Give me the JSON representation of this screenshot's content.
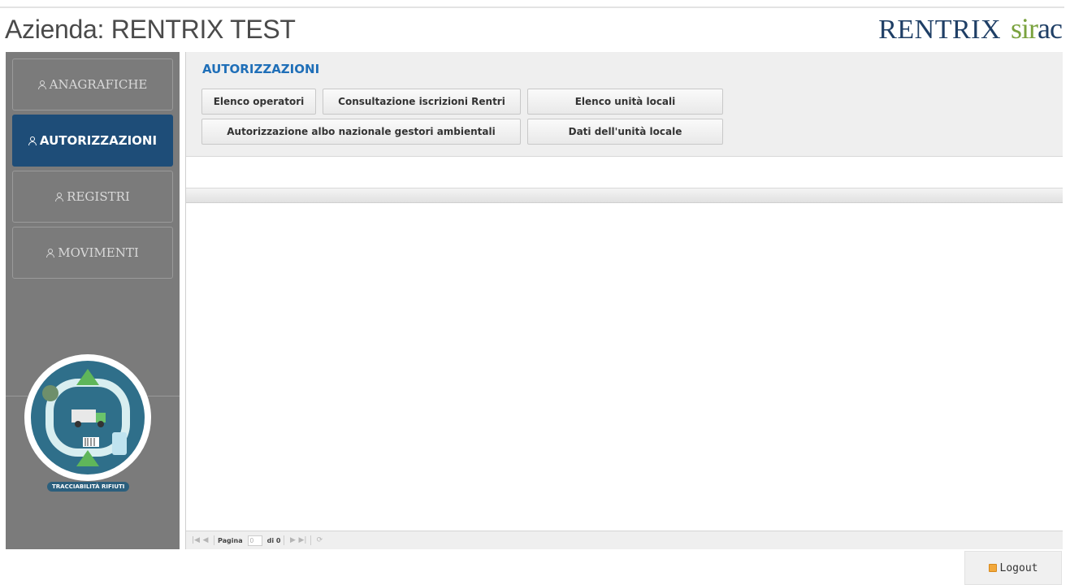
{
  "header": {
    "company_title": "Azienda: RENTRIX TEST",
    "brand_main": "RENTRIX",
    "brand_sub_a": "sir",
    "brand_sub_b": "ac"
  },
  "sidebar": {
    "items": [
      {
        "label": "ANAGRAFICHE",
        "active": false
      },
      {
        "label": "AUTORIZZAZIONI",
        "active": true
      },
      {
        "label": "REGISTRI",
        "active": false
      },
      {
        "label": "MOVIMENTI",
        "active": false
      }
    ],
    "logo_caption": "TRACCIABILITÀ RIFIUTI"
  },
  "main": {
    "section_title": "AUTORIZZAZIONI",
    "buttons": [
      "Elenco operatori",
      "Consultazione iscrizioni Rentri",
      "Elenco unità locali",
      "Autorizzazione albo nazionale gestori ambientali",
      "Dati dell'unità locale"
    ]
  },
  "pager": {
    "page_label": "Pagina",
    "page_value": "0",
    "of_label": "di 0"
  },
  "logout_label": "Logout",
  "colors": {
    "sidebar_bg": "#7b7b7b",
    "active_bg": "#1e4d78",
    "title_blue": "#1f6fb8"
  }
}
